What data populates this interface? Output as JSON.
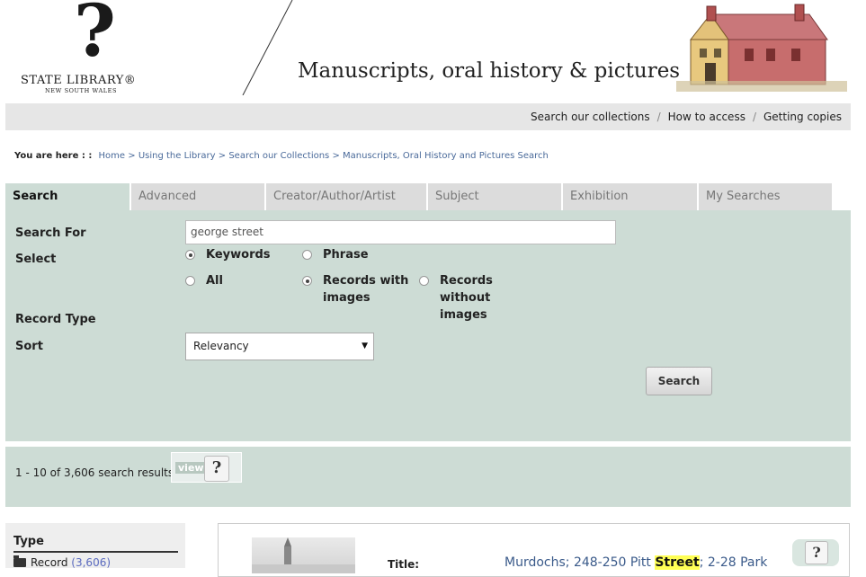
{
  "header": {
    "logo_name": "STATE LIBRARY®",
    "logo_sub": "NEW SOUTH WALES",
    "banner_title": "Manuscripts, oral history & pictures"
  },
  "topnav": {
    "items": [
      "Search our collections",
      "How to access",
      "Getting copies"
    ],
    "separator": "/"
  },
  "breadcrumb": {
    "lead": "You are here : :",
    "items": [
      "Home",
      "Using the Library",
      "Search our Collections",
      "Manuscripts, Oral History and Pictures Search"
    ],
    "separator": ">"
  },
  "tabs": [
    "Search",
    "Advanced",
    "Creator/Author/Artist",
    "Subject",
    "Exhibition",
    "My Searches"
  ],
  "active_tab": "Search",
  "form": {
    "search_for_label": "Search For",
    "search_value": "george street",
    "select_label": "Select",
    "options_row1": [
      {
        "label": "Keywords",
        "checked": true
      },
      {
        "label": "Phrase",
        "checked": false
      }
    ],
    "options_row2": [
      {
        "label": "All",
        "checked": false
      },
      {
        "label": "Records with images",
        "checked": true
      },
      {
        "label": "Records without images",
        "checked": false
      }
    ],
    "record_type_label": "Record Type",
    "sort_label": "Sort",
    "sort_value": "Relevancy",
    "search_button": "Search"
  },
  "results": {
    "count_text": "1 - 10 of 3,606 search results",
    "view_label": "view"
  },
  "sidebar": {
    "heading": "Type",
    "item_label": "Record",
    "item_count": "(3,606)"
  },
  "record": {
    "title_label": "Title:",
    "title_before": "Murdochs; 248-250 Pitt ",
    "title_highlight": "Street",
    "title_after": "; 2-28 Park"
  },
  "colors": {
    "panel": "#cddcd5",
    "link": "#4a6a9a",
    "highlight": "#ffff55"
  }
}
